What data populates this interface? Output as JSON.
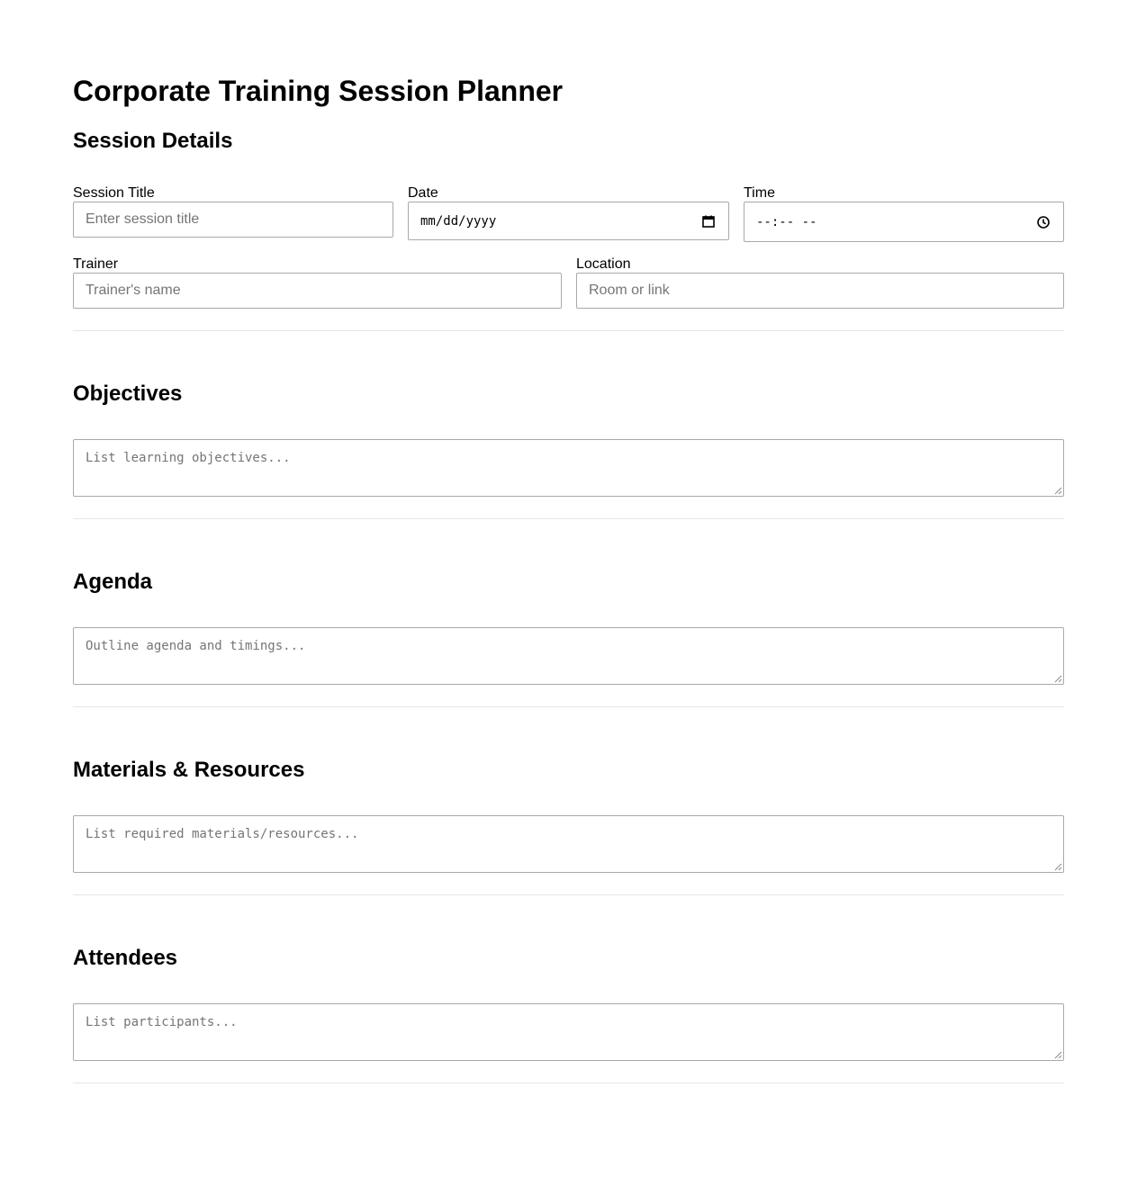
{
  "page": {
    "title": "Corporate Training Session Planner"
  },
  "session_details": {
    "heading": "Session Details",
    "session_title": {
      "label": "Session Title",
      "placeholder": "Enter session title"
    },
    "date": {
      "label": "Date",
      "value": "mm/dd/yyyy",
      "icon": "calendar-icon"
    },
    "time": {
      "label": "Time",
      "value": "--:-- --",
      "icon": "clock-icon"
    },
    "trainer": {
      "label": "Trainer",
      "placeholder": "Trainer's name"
    },
    "location": {
      "label": "Location",
      "placeholder": "Room or link"
    }
  },
  "objectives": {
    "heading": "Objectives",
    "placeholder": "List learning objectives..."
  },
  "agenda": {
    "heading": "Agenda",
    "placeholder": "Outline agenda and timings..."
  },
  "materials": {
    "heading": "Materials & Resources",
    "placeholder": "List required materials/resources..."
  },
  "attendees": {
    "heading": "Attendees",
    "placeholder": "List participants..."
  },
  "colors": {
    "border": "#a9a9a9",
    "placeholder": "#757575",
    "divider": "#e6e6e6"
  }
}
